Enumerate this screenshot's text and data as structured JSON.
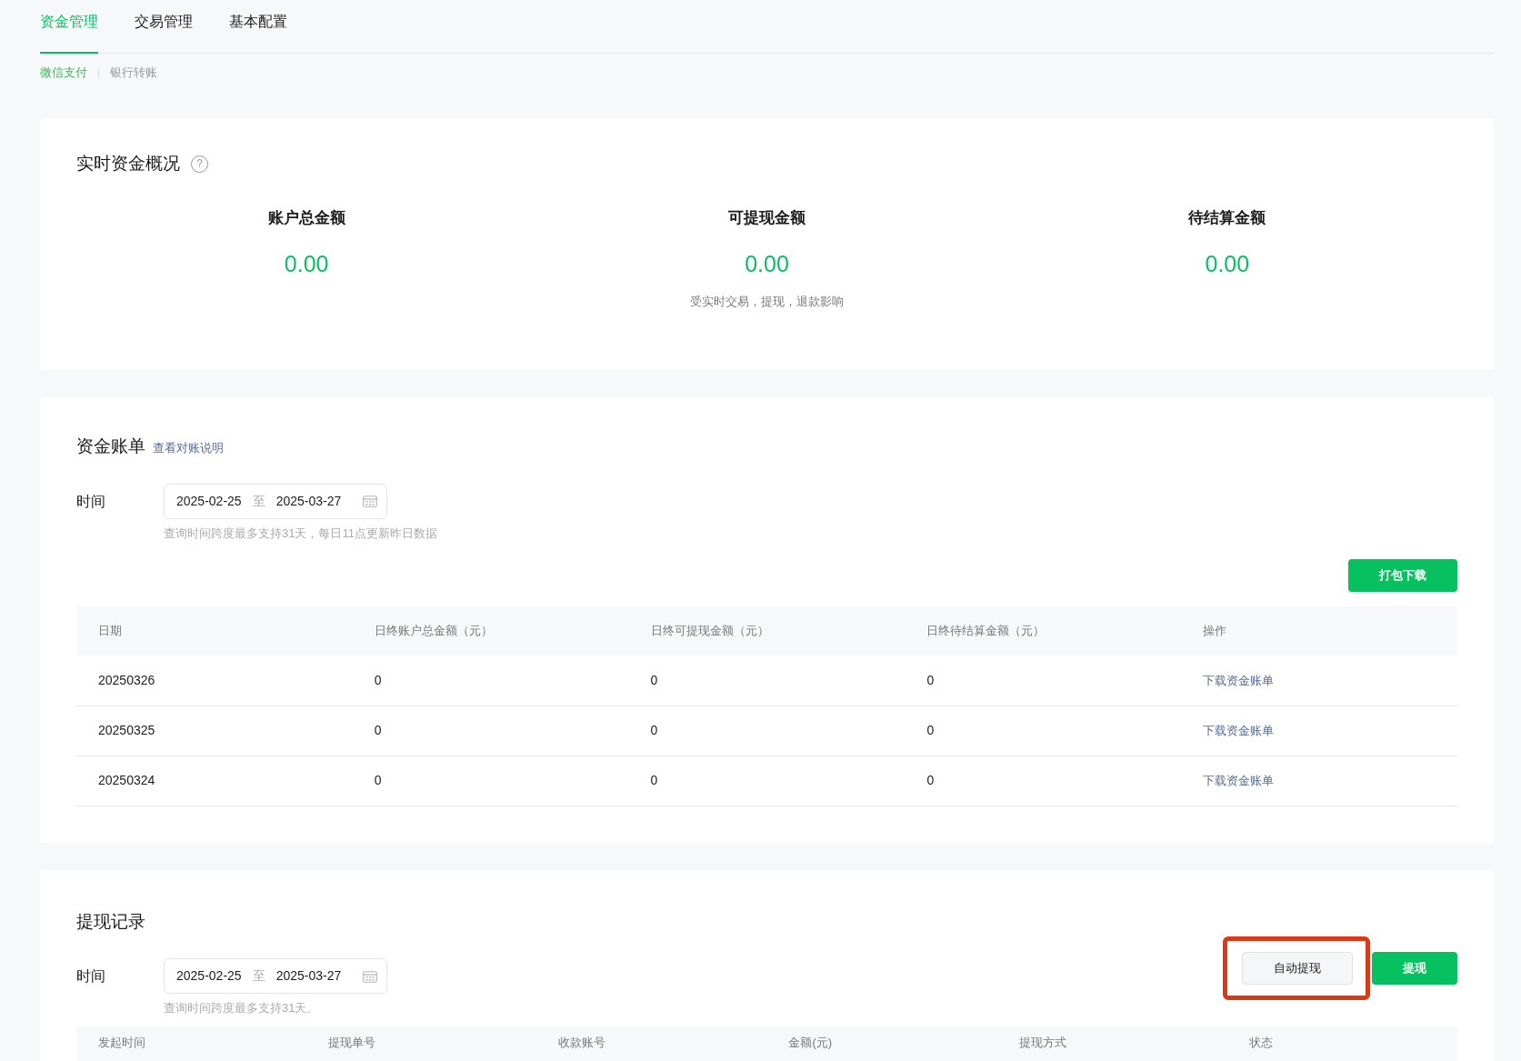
{
  "tabs": [
    {
      "label": "资金管理",
      "selected": true
    },
    {
      "label": "交易管理",
      "selected": false
    },
    {
      "label": "基本配置",
      "selected": false
    }
  ],
  "subtabs": [
    {
      "label": "微信支付",
      "selected": true
    },
    {
      "label": "银行转账",
      "selected": false
    }
  ],
  "overview": {
    "title": "实时资金概况",
    "help": "?",
    "amounts": [
      {
        "label": "账户总金额",
        "value": "0.00"
      },
      {
        "label": "可提现金额",
        "value": "0.00",
        "note": "受实时交易，提现，退款影响"
      },
      {
        "label": "待结算金额",
        "value": "0.00"
      }
    ]
  },
  "bill": {
    "title": "资金账单",
    "link": "查看对账说明",
    "filter": {
      "label": "时间",
      "start": "2025-02-25",
      "separator": "至",
      "end": "2025-03-27",
      "hint": "查询时间跨度最多支持31天，每日11点更新昨日数据"
    },
    "buttons": [
      {
        "label": "打包下载",
        "kind": "primary",
        "highlighted": false
      }
    ],
    "table": {
      "columns": [
        "日期",
        "日终账户总金额（元）",
        "日终可提现金额（元）",
        "日终待结算金额（元）",
        "操作"
      ],
      "rows": [
        [
          "20250326",
          "0",
          "0",
          "0",
          "下载资金账单"
        ],
        [
          "20250325",
          "0",
          "0",
          "0",
          "下载资金账单"
        ],
        [
          "20250324",
          "0",
          "0",
          "0",
          "下载资金账单"
        ]
      ]
    }
  },
  "withdrawals": {
    "title": "提现记录",
    "filter": {
      "label": "时间",
      "start": "2025-02-25",
      "separator": "至",
      "end": "2025-03-27",
      "hint": "查询时间跨度最多支持31天。"
    },
    "buttons": [
      {
        "label": "自动提现",
        "kind": "default",
        "highlighted": true
      },
      {
        "label": "提现",
        "kind": "primary",
        "highlighted": false
      }
    ],
    "table": {
      "columns": [
        "发起时间",
        "提现单号",
        "收款账号",
        "金额(元)",
        "提现方式",
        "状态"
      ]
    }
  }
}
